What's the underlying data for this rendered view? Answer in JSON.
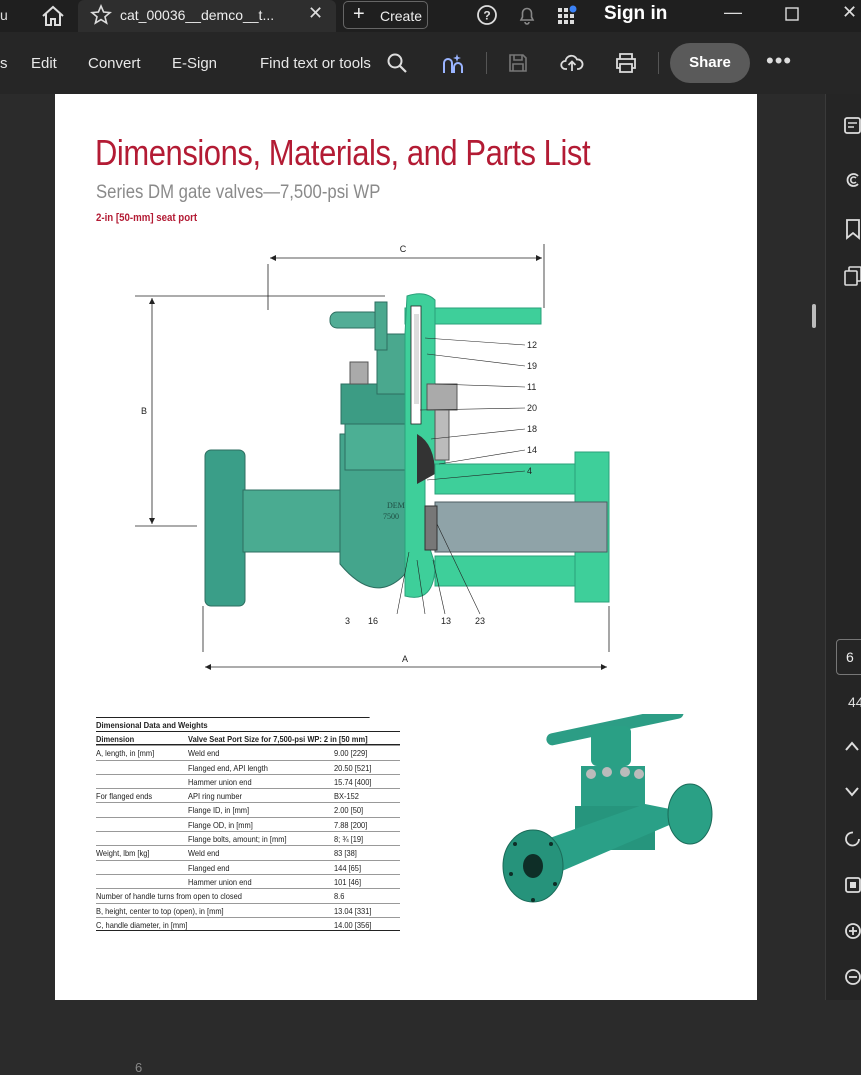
{
  "titlebar": {
    "edge_text": "u",
    "tab_title": "cat_00036__demco__t...",
    "create_label": "Create",
    "signin_label": "Sign in"
  },
  "toolbar": {
    "edge_text": "s",
    "edit_label": "Edit",
    "convert_label": "Convert",
    "esign_label": "E-Sign",
    "find_label": "Find text or tools",
    "share_label": "Share"
  },
  "document": {
    "title": "Dimensions, Materials, and Parts List",
    "subtitle": "Series DM gate valves—7,500-psi WP",
    "section": "2-in [50-mm] seat port",
    "diagram_labels": {
      "A": "A",
      "B": "B",
      "C": "C",
      "callouts_right": [
        "12",
        "19",
        "11",
        "20",
        "18",
        "14",
        "4"
      ],
      "callouts_bottom": [
        "3",
        "16",
        "13",
        "23"
      ],
      "body_marking": [
        "DEM",
        "7500"
      ]
    },
    "table": {
      "title": "Dimensional Data and Weights",
      "header_c1": "Dimension",
      "header_c2": "Valve Seat Port Size for 7,500-psi WP: 2 in [50 mm]",
      "rows": [
        [
          "A, length, in [mm]",
          "Weld end",
          "9.00 [229]"
        ],
        [
          "",
          "Flanged end, API length",
          "20.50 [521]"
        ],
        [
          "",
          "Hammer union end",
          "15.74 [400]"
        ],
        [
          "For flanged ends",
          "API ring number",
          "BX-152"
        ],
        [
          "",
          "Flange ID, in [mm]",
          "2.00 [50]"
        ],
        [
          "",
          "Flange OD, in [mm]",
          "7.88 [200]"
        ],
        [
          "",
          "Flange bolts, amount; in [mm]",
          "8; ¾ [19]"
        ],
        [
          "Weight, lbm [kg]",
          "Weld end",
          "83 [38]"
        ],
        [
          "",
          "Flanged end",
          "144 [65]"
        ],
        [
          "",
          "Hammer union end",
          "101 [46]"
        ],
        [
          "Number of handle turns from open to closed",
          "",
          "8.6"
        ],
        [
          "B, height, center to top (open), in [mm]",
          "",
          "13.04 [331]"
        ],
        [
          "C, handle diameter, in [mm]",
          "",
          "14.00 [356]"
        ]
      ]
    },
    "page_number": "6"
  },
  "sidepanel": {
    "current_page": "6",
    "page_count": "44"
  },
  "colors": {
    "accent_red": "#b31b34",
    "valve_green": "#3ecf9a",
    "toolbar_bg": "#262626"
  }
}
